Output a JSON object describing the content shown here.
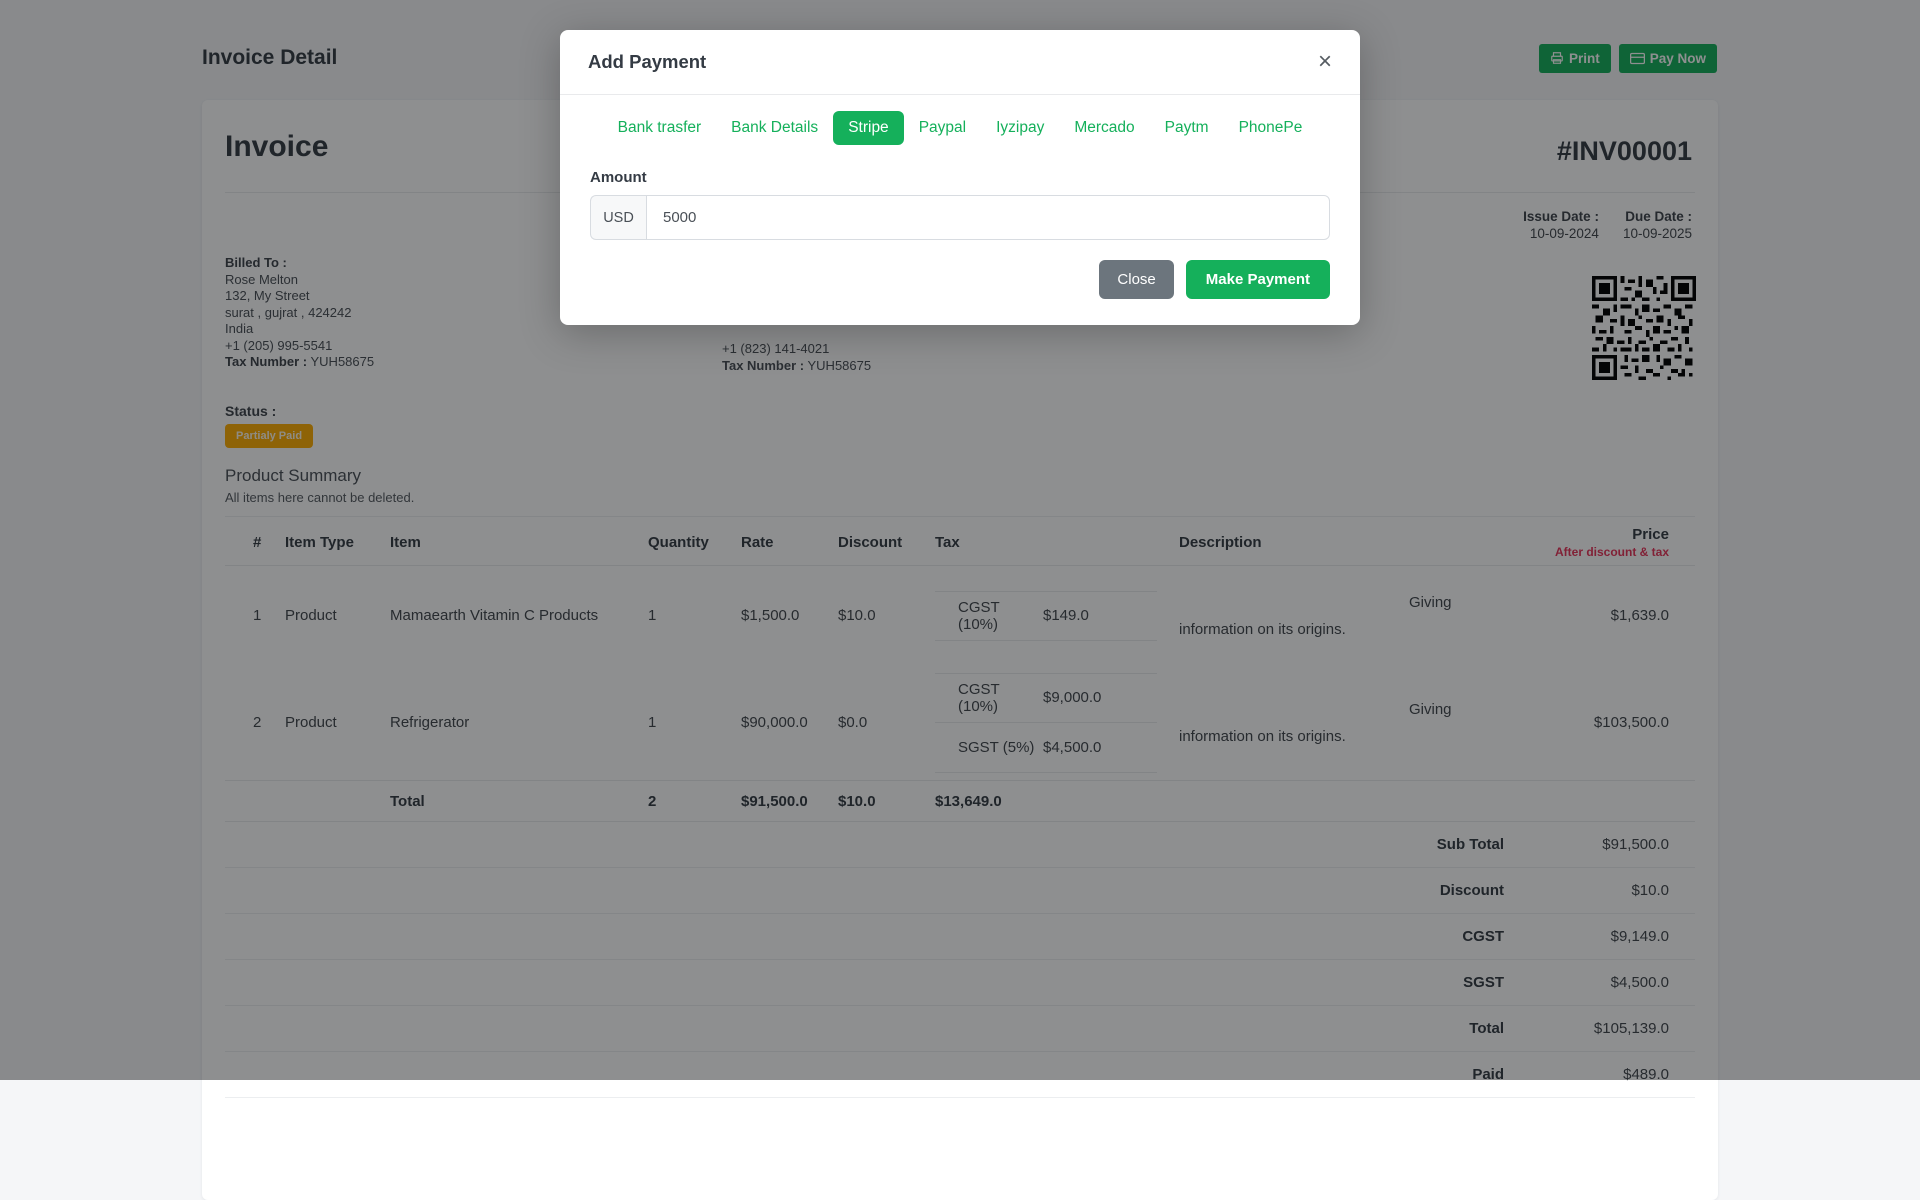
{
  "page": {
    "title": "Invoice Detail",
    "print_label": "Print",
    "pay_now_label": "Pay Now"
  },
  "invoice": {
    "heading": "Invoice",
    "number": "#INV00001",
    "billed_to": {
      "label": "Billed To :",
      "name": "Rose Melton",
      "address1": "132, My Street",
      "address2": "surat , gujrat , 424242",
      "country": "India",
      "phone": "+1 (205) 995-5541",
      "tax_label": "Tax Number :",
      "tax_number": "YUH58675"
    },
    "shipped_to": {
      "phone": "+1 (823) 141-4021",
      "tax_label": "Tax Number :",
      "tax_number": "YUH58675"
    },
    "issue_date": {
      "label": "Issue Date :",
      "value": "10-09-2024"
    },
    "due_date": {
      "label": "Due Date :",
      "value": "10-09-2025"
    },
    "status_label": "Status :",
    "status_value": "Partialy Paid"
  },
  "product_summary": {
    "title": "Product Summary",
    "subtitle": "All items here cannot be deleted.",
    "headers": {
      "num": "#",
      "item_type": "Item Type",
      "item": "Item",
      "quantity": "Quantity",
      "rate": "Rate",
      "discount": "Discount",
      "tax": "Tax",
      "description": "Description",
      "price": "Price",
      "price_sub": "After discount & tax"
    },
    "rows": [
      {
        "index": "1",
        "item_type": "Product",
        "item": "Mamaearth Vitamin C Products",
        "quantity": "1",
        "rate": "$1,500.0",
        "discount": "$10.0",
        "taxes": [
          {
            "name": "CGST (10%)",
            "value": "$149.0"
          }
        ],
        "description": "Giving information on its origins.",
        "price": "$1,639.0"
      },
      {
        "index": "2",
        "item_type": "Product",
        "item": "Refrigerator",
        "quantity": "1",
        "rate": "$90,000.0",
        "discount": "$0.0",
        "taxes": [
          {
            "name": "CGST (10%)",
            "value": "$9,000.0"
          },
          {
            "name": "SGST (5%)",
            "value": "$4,500.0"
          }
        ],
        "description": "Giving information on its origins.",
        "price": "$103,500.0"
      }
    ],
    "total_row": {
      "label": "Total",
      "quantity": "2",
      "rate": "$91,500.0",
      "discount": "$10.0",
      "tax": "$13,649.0"
    },
    "summary": [
      {
        "label": "Sub Total",
        "value": "$91,500.0"
      },
      {
        "label": "Discount",
        "value": "$10.0"
      },
      {
        "label": "CGST",
        "value": "$9,149.0"
      },
      {
        "label": "SGST",
        "value": "$4,500.0"
      },
      {
        "label": "Total",
        "value": "$105,139.0"
      },
      {
        "label": "Paid",
        "value": "$489.0"
      }
    ]
  },
  "modal": {
    "title": "Add Payment",
    "close_icon": "×",
    "tabs": [
      {
        "label": "Bank trasfer"
      },
      {
        "label": "Bank Details"
      },
      {
        "label": "Stripe"
      },
      {
        "label": "Paypal"
      },
      {
        "label": "Iyzipay"
      },
      {
        "label": "Mercado"
      },
      {
        "label": "Paytm"
      },
      {
        "label": "PhonePe"
      }
    ],
    "amount_label": "Amount",
    "currency_prefix": "USD",
    "amount_value": "5000",
    "close_button": "Close",
    "make_payment_button": "Make Payment"
  },
  "colors": {
    "accent_green": "#15b05b",
    "badge_amber": "#ffae02",
    "price_sub_red": "#e8345a"
  }
}
